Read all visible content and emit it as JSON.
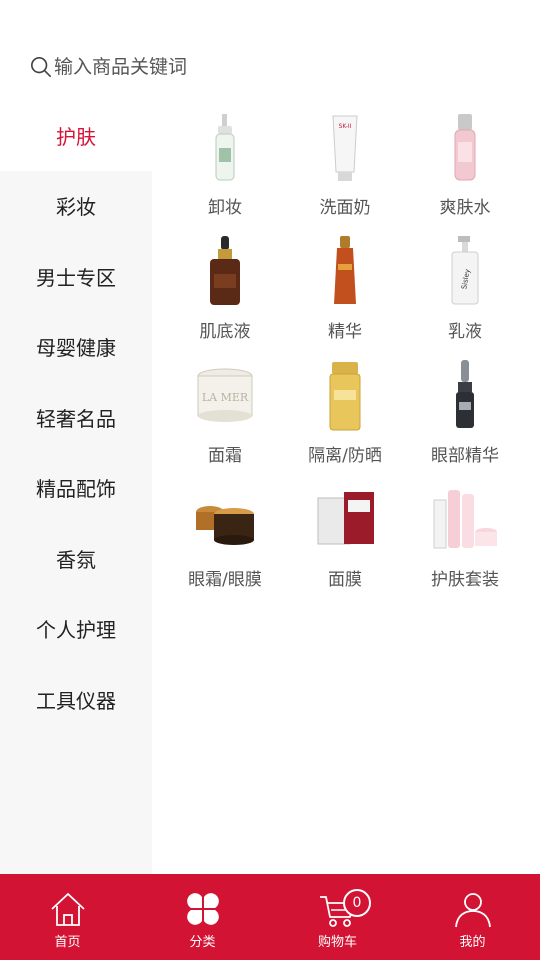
{
  "search": {
    "placeholder": "输入商品关键词"
  },
  "sidebar": {
    "items": [
      {
        "label": "护肤",
        "active": true
      },
      {
        "label": "彩妆"
      },
      {
        "label": "男士专区"
      },
      {
        "label": "母婴健康"
      },
      {
        "label": "轻奢名品"
      },
      {
        "label": "精品配饰"
      },
      {
        "label": "香氛"
      },
      {
        "label": "个人护理"
      },
      {
        "label": "工具仪器"
      }
    ]
  },
  "products": [
    {
      "label": "卸妆",
      "icon": "cleansing-oil-bottle-icon"
    },
    {
      "label": "洗面奶",
      "icon": "facial-cleanser-tube-icon"
    },
    {
      "label": "爽肤水",
      "icon": "toner-bottle-icon"
    },
    {
      "label": "肌底液",
      "icon": "serum-dropper-bottle-icon"
    },
    {
      "label": "精华",
      "icon": "essence-bottle-icon"
    },
    {
      "label": "乳液",
      "icon": "lotion-pump-bottle-icon"
    },
    {
      "label": "面霜",
      "icon": "face-cream-jar-icon"
    },
    {
      "label": "隔离/防晒",
      "icon": "sunscreen-bottle-icon"
    },
    {
      "label": "眼部精华",
      "icon": "eye-serum-bottle-icon"
    },
    {
      "label": "眼霜/眼膜",
      "icon": "eye-cream-jar-icon"
    },
    {
      "label": "面膜",
      "icon": "face-mask-box-icon"
    },
    {
      "label": "护肤套装",
      "icon": "skincare-set-icon"
    }
  ],
  "brand_text": {
    "lamer": "LA MER",
    "skii": "SK-II",
    "sisley": "Sisley"
  },
  "tabbar": {
    "home": "首页",
    "category": "分类",
    "cart": "购物车",
    "cart_count": "0",
    "mine": "我的"
  },
  "colors": {
    "accent": "#d31334",
    "active_text": "#d6143a",
    "sidebar_bg": "#f7f7f7"
  }
}
